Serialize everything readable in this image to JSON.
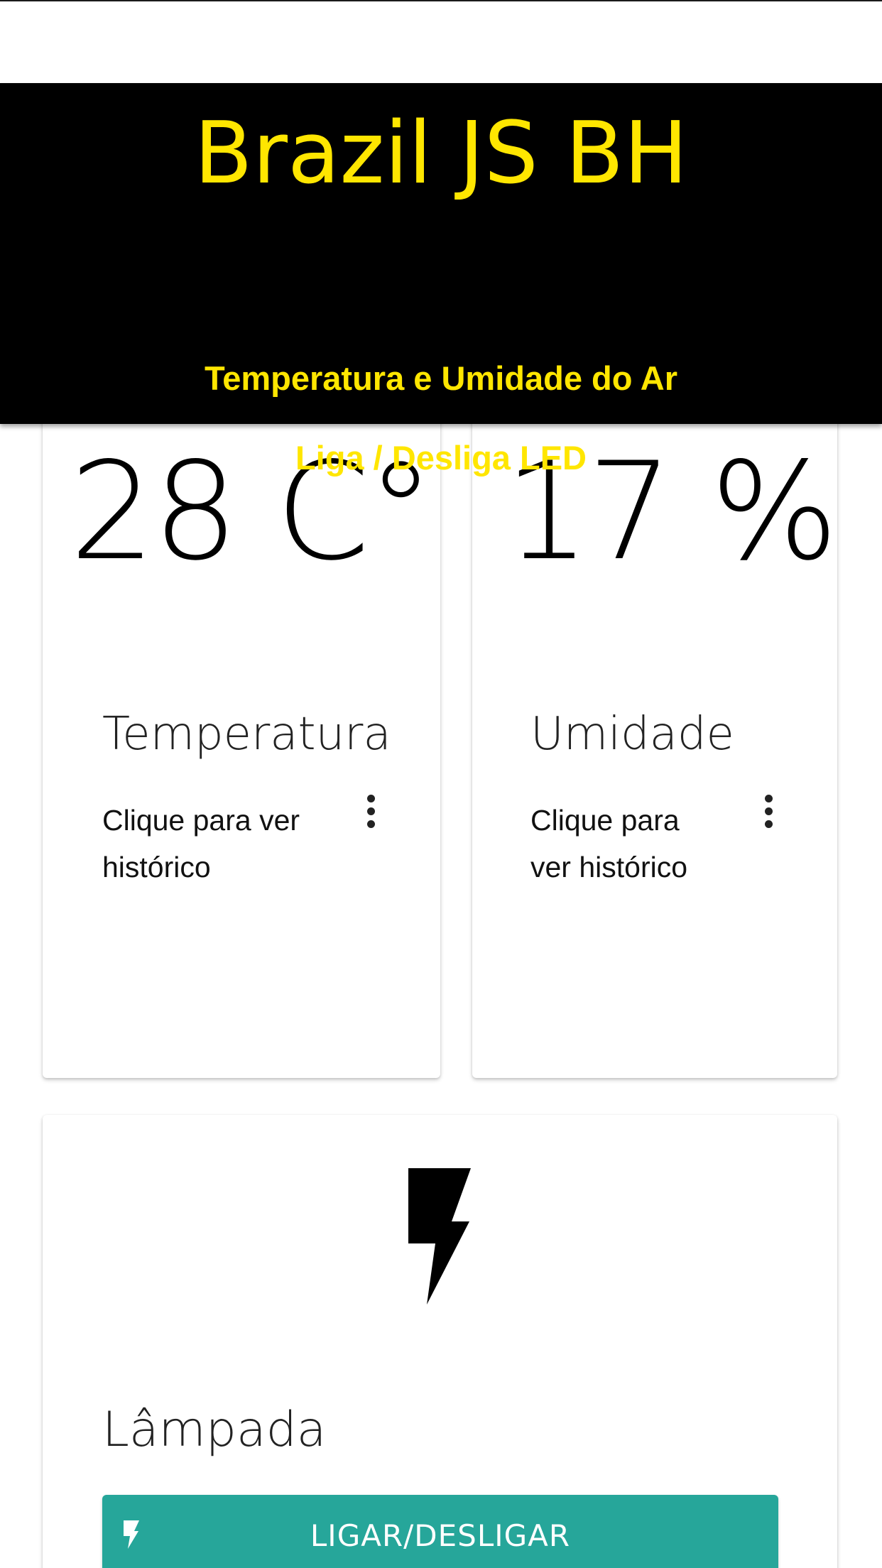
{
  "header": {
    "title": "Brazil JS BH",
    "links": [
      {
        "label": "Temperatura e Umidade do Ar"
      },
      {
        "label": "Liga / Desliga LED"
      }
    ]
  },
  "cards": {
    "temperature": {
      "value": "28 C°",
      "title": "Temperatura",
      "subtitle_line1": "Clique para ver",
      "subtitle_line2": "histórico",
      "menu_icon": "more-vert-icon"
    },
    "humidity": {
      "value": "17 %",
      "title": "Umidade",
      "subtitle_line1": "Clique para",
      "subtitle_line2": "ver histórico",
      "menu_icon": "more-vert-icon"
    },
    "lamp": {
      "icon": "flash-on-icon",
      "title": "Lâmpada",
      "button_label": "LIGAR/DESLIGAR",
      "button_icon": "flash-on-icon"
    }
  },
  "colors": {
    "header_background": "#000000",
    "header_text": "#ffe600",
    "button_background": "#26a69a",
    "button_text": "#ffffff"
  }
}
